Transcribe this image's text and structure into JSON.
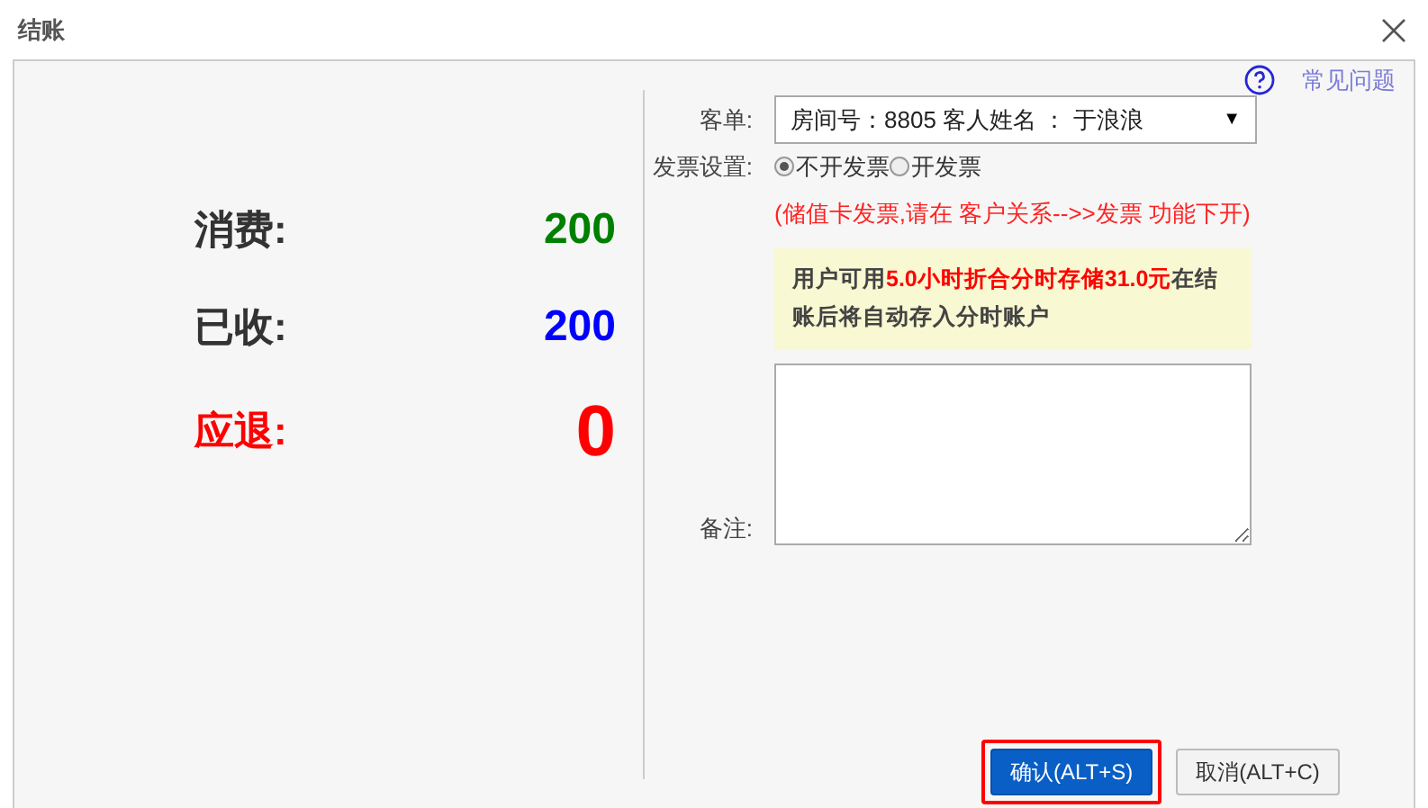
{
  "window": {
    "title": "结账"
  },
  "help_link": "常见问题",
  "summary": [
    {
      "label": "消费:",
      "value": "200",
      "color": "#008000",
      "kind": "normal"
    },
    {
      "label": "已收:",
      "value": "200",
      "color": "#0000ff",
      "kind": "normal"
    },
    {
      "label": "应退:",
      "value": "0",
      "color": "#ff0000",
      "kind": "emphasis"
    }
  ],
  "order": {
    "label": "客单:",
    "value": "房间号：8805 客人姓名 ： 于浪浪",
    "caret": "▼"
  },
  "invoice": {
    "label": "发票设置:",
    "options": [
      {
        "label": "不开发票",
        "selected": true
      },
      {
        "label": "开发票",
        "selected": false
      }
    ],
    "hint": "(储值卡发票,请在 客户关系-->>发票 功能下开)"
  },
  "notice": "用户可用**5.0小时折合分时存储31.0元**在结账后将自动存入分时账户",
  "remarks": {
    "label": "备注:"
  },
  "buttons": [
    {
      "label": "确认(ALT+S)",
      "kind": "primary",
      "highlighted": true
    },
    {
      "label": "取消(ALT+C)",
      "kind": "secondary",
      "highlighted": false
    }
  ]
}
